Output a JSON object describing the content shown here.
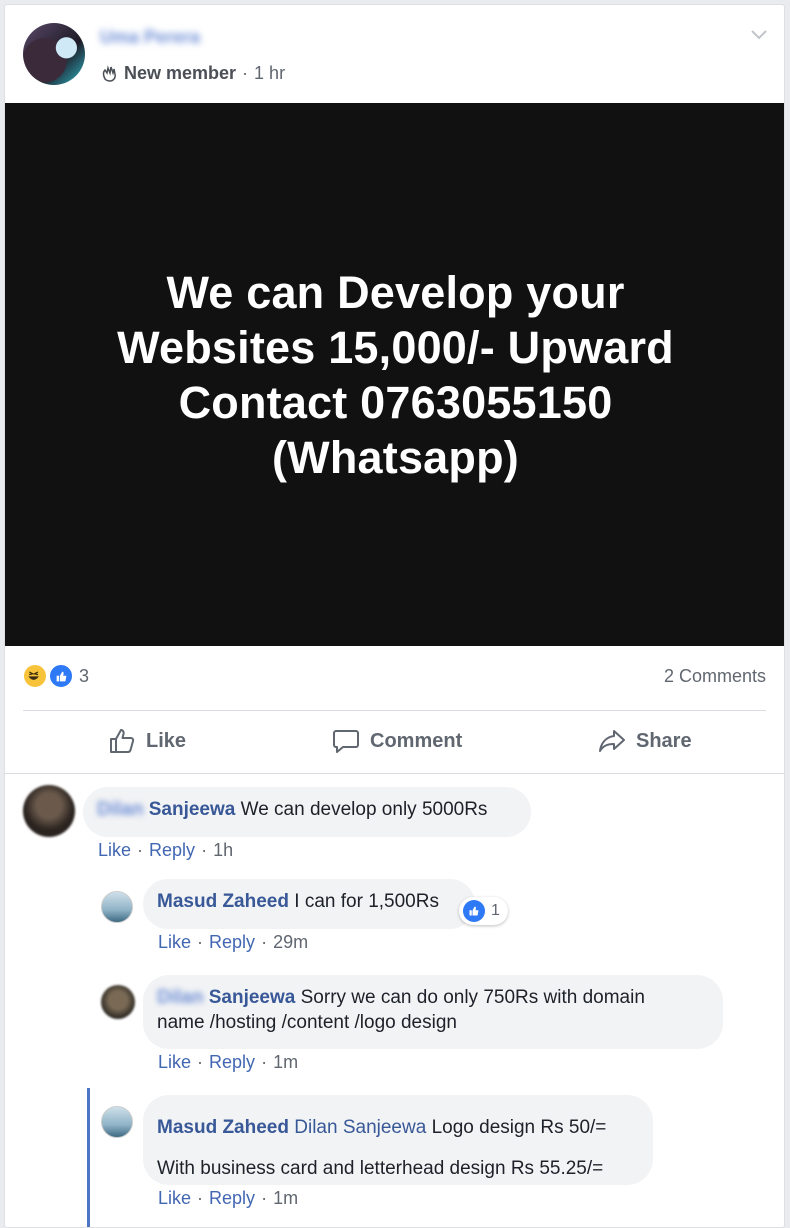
{
  "post": {
    "author_name": "Uma Perera",
    "badge": "New member",
    "time": "1 hr",
    "image_text": "We can Develop your\nWebsites 15,000/- Upward\nContact 0763055150\n(Whatsapp)"
  },
  "reactions": {
    "count": "3",
    "comments_label": "2 Comments"
  },
  "actions": {
    "like": "Like",
    "comment": "Comment",
    "share": "Share"
  },
  "comments": [
    {
      "name_hidden": "Dilan",
      "name": "Sanjeewa",
      "text": "We can develop only 5000Rs",
      "like": "Like",
      "reply": "Reply",
      "time": "1h"
    },
    {
      "name": "Masud Zaheed",
      "text": "I can for 1,500Rs",
      "reaction_count": "1",
      "like": "Like",
      "reply": "Reply",
      "time": "29m"
    },
    {
      "name_hidden": "Dilan",
      "name": "Sanjeewa",
      "text_line1": "Sorry we can do only 750Rs with domain",
      "text_line2": "name /hosting /content /logo design",
      "like": "Like",
      "reply": "Reply",
      "time": "1m"
    },
    {
      "name": "Masud Zaheed",
      "mention": "Dilan Sanjeewa",
      "text_line1": "Logo design Rs 50/=",
      "text_line2": "With business card and letterhead design Rs 55.25/=",
      "like": "Like",
      "reply": "Reply",
      "time": "1m"
    }
  ],
  "colors": {
    "link_blue": "#385898",
    "like_blue": "#2e79f6",
    "haha_yellow": "#f7c33a",
    "bubble_gray": "#f2f3f5"
  }
}
